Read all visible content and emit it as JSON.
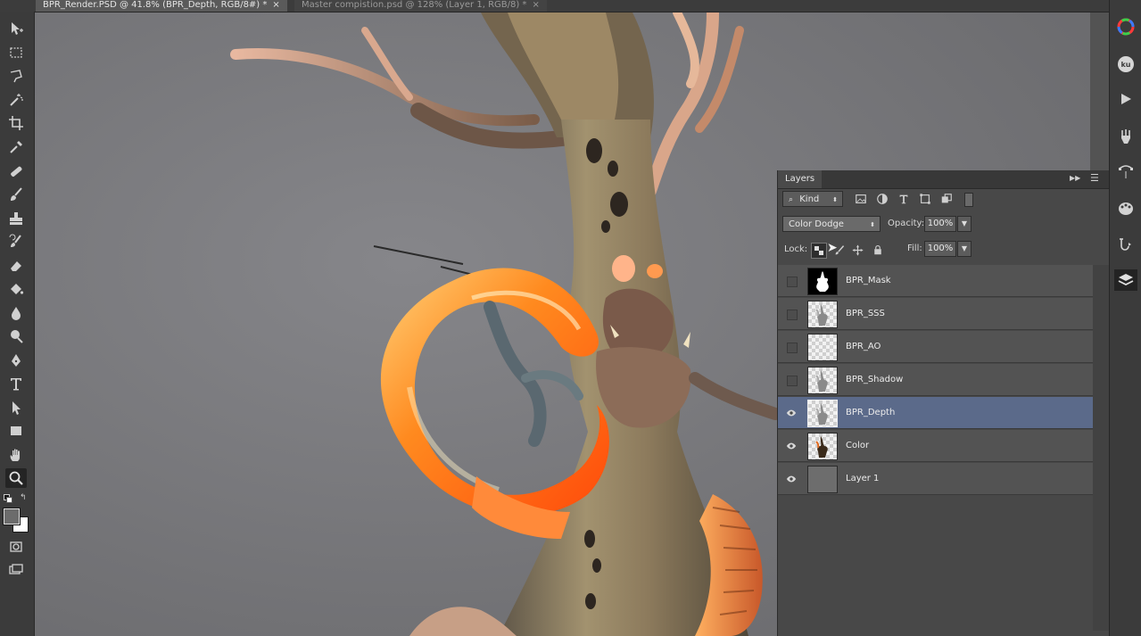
{
  "tabs": [
    {
      "label": "BPR_Render.PSD @ 41.8% (BPR_Depth, RGB/8#) *",
      "active": true
    },
    {
      "label": "Master compistion.psd @ 128% (Layer 1, RGB/8) *",
      "active": false
    }
  ],
  "tab_close_glyph": "×",
  "toolbar": {
    "tools": [
      "move-icon",
      "marquee-icon",
      "lasso-icon",
      "magic-wand-icon",
      "crop-icon",
      "eyedropper-icon",
      "healing-brush-icon",
      "brush-icon",
      "clone-stamp-icon",
      "history-brush-icon",
      "eraser-icon",
      "paint-bucket-icon",
      "blur-icon",
      "dodge-icon",
      "pen-icon",
      "type-icon",
      "path-select-icon",
      "rectangle-icon",
      "hand-icon",
      "zoom-icon"
    ],
    "selected_tool": "zoom-icon",
    "foreground_color": "#6c6c6c",
    "background_color": "#ffffff"
  },
  "dock": {
    "icons": [
      "color-wheel-icon",
      "kuler-icon",
      "play-actions-icon",
      "brush-presets-icon",
      "paths-icon",
      "swatches-icon",
      "history-icon",
      "layers-icon"
    ],
    "kuler_text": "ku",
    "selected": "layers-icon"
  },
  "layers_panel": {
    "title": "Layers",
    "filter_label": "Kind",
    "blend_mode": "Color Dodge",
    "opacity_label": "Opacity:",
    "opacity_value": "100%",
    "lock_label": "Lock:",
    "fill_label": "Fill:",
    "fill_value": "100%",
    "layers": [
      {
        "name": "BPR_Mask",
        "visible": false,
        "selected": false,
        "thumb": "mask"
      },
      {
        "name": "BPR_SSS",
        "visible": false,
        "selected": false,
        "thumb": "figure"
      },
      {
        "name": "BPR_AO",
        "visible": false,
        "selected": false,
        "thumb": "empty"
      },
      {
        "name": "BPR_Shadow",
        "visible": false,
        "selected": false,
        "thumb": "figure"
      },
      {
        "name": "BPR_Depth",
        "visible": true,
        "selected": true,
        "thumb": "figure"
      },
      {
        "name": "Color",
        "visible": true,
        "selected": false,
        "thumb": "color"
      },
      {
        "name": "Layer 1",
        "visible": true,
        "selected": false,
        "thumb": "gray"
      }
    ]
  },
  "colors": {
    "canvas": "#7a7a7d",
    "selected_layer": "#5b6a8a",
    "horn_orange": "#ff7a1a",
    "bark": "#8a7a5e"
  }
}
